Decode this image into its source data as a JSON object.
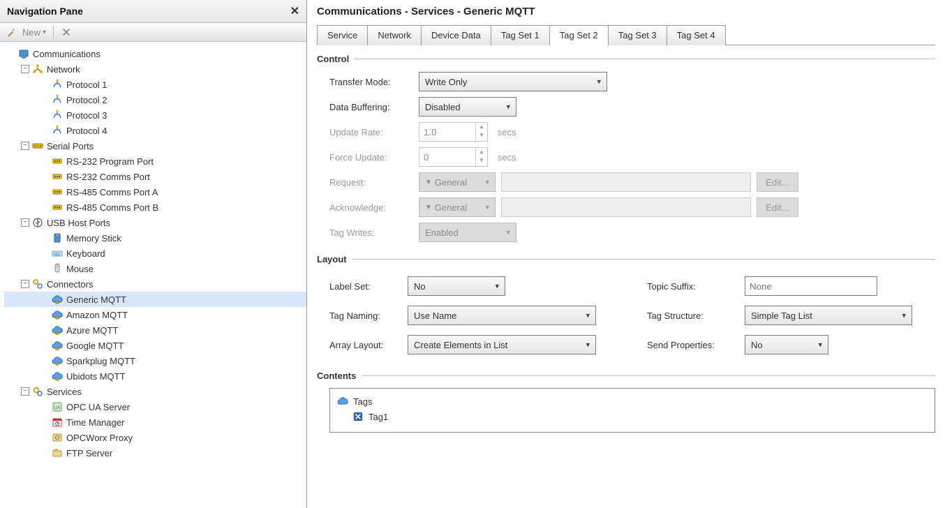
{
  "nav": {
    "title": "Navigation Pane",
    "toolbar": {
      "new": "New",
      "new_arrow": "▾"
    },
    "items": [
      {
        "label": "Communications",
        "level": 1,
        "icon": "comm",
        "expander": ""
      },
      {
        "label": "Network",
        "level": 2,
        "icon": "network",
        "expander": "−"
      },
      {
        "label": "Protocol 1",
        "level": 3,
        "icon": "protocol",
        "expander": ""
      },
      {
        "label": "Protocol 2",
        "level": 3,
        "icon": "protocol",
        "expander": ""
      },
      {
        "label": "Protocol 3",
        "level": 3,
        "icon": "protocol",
        "expander": ""
      },
      {
        "label": "Protocol 4",
        "level": 3,
        "icon": "protocol",
        "expander": ""
      },
      {
        "label": "Serial Ports",
        "level": 2,
        "icon": "serial",
        "expander": "−"
      },
      {
        "label": "RS-232 Program Port",
        "level": 3,
        "icon": "port",
        "expander": ""
      },
      {
        "label": "RS-232 Comms Port",
        "level": 3,
        "icon": "port",
        "expander": ""
      },
      {
        "label": "RS-485 Comms Port A",
        "level": 3,
        "icon": "port",
        "expander": ""
      },
      {
        "label": "RS-485 Comms Port B",
        "level": 3,
        "icon": "port",
        "expander": ""
      },
      {
        "label": "USB Host Ports",
        "level": 2,
        "icon": "usb",
        "expander": "−"
      },
      {
        "label": "Memory Stick",
        "level": 3,
        "icon": "mstick",
        "expander": ""
      },
      {
        "label": "Keyboard",
        "level": 3,
        "icon": "keyboard",
        "expander": ""
      },
      {
        "label": "Mouse",
        "level": 3,
        "icon": "mouse",
        "expander": ""
      },
      {
        "label": "Connectors",
        "level": 2,
        "icon": "connectors",
        "expander": "−"
      },
      {
        "label": "Generic MQTT",
        "level": 3,
        "icon": "cloud",
        "expander": "",
        "selected": true
      },
      {
        "label": "Amazon MQTT",
        "level": 3,
        "icon": "cloud",
        "expander": ""
      },
      {
        "label": "Azure MQTT",
        "level": 3,
        "icon": "cloud",
        "expander": ""
      },
      {
        "label": "Google MQTT",
        "level": 3,
        "icon": "cloud",
        "expander": ""
      },
      {
        "label": "Sparkplug MQTT",
        "level": 3,
        "icon": "cloud",
        "expander": ""
      },
      {
        "label": "Ubidots MQTT",
        "level": 3,
        "icon": "cloud",
        "expander": ""
      },
      {
        "label": "Services",
        "level": 2,
        "icon": "services",
        "expander": "−"
      },
      {
        "label": "OPC UA Server",
        "level": 3,
        "icon": "opcua",
        "expander": ""
      },
      {
        "label": "Time Manager",
        "level": 3,
        "icon": "clock",
        "expander": ""
      },
      {
        "label": "OPCWorx Proxy",
        "level": 3,
        "icon": "opcproxy",
        "expander": ""
      },
      {
        "label": "FTP Server",
        "level": 3,
        "icon": "ftp",
        "expander": ""
      }
    ]
  },
  "main": {
    "breadcrumb": "Communications - Services - Generic MQTT",
    "tabs": [
      "Service",
      "Network",
      "Device Data",
      "Tag Set 1",
      "Tag Set 2",
      "Tag Set 3",
      "Tag Set 4"
    ],
    "active_tab": 4,
    "groups": {
      "control": {
        "title": "Control",
        "transfer_mode": {
          "label": "Transfer Mode:",
          "value": "Write Only"
        },
        "data_buffering": {
          "label": "Data Buffering:",
          "value": "Disabled"
        },
        "update_rate": {
          "label": "Update Rate:",
          "value": "1.0",
          "unit": "secs"
        },
        "force_update": {
          "label": "Force Update:",
          "value": "0",
          "unit": "secs"
        },
        "request": {
          "label": "Request:",
          "combo": "General",
          "edit": "Edit..."
        },
        "acknowledge": {
          "label": "Acknowledge:",
          "combo": "General",
          "edit": "Edit..."
        },
        "tag_writes": {
          "label": "Tag Writes:",
          "value": "Enabled"
        }
      },
      "layout": {
        "title": "Layout",
        "label_set": {
          "label": "Label Set:",
          "value": "No"
        },
        "topic_suffix": {
          "label": "Topic Suffix:",
          "placeholder": "None",
          "value": ""
        },
        "tag_naming": {
          "label": "Tag Naming:",
          "value": "Use Name"
        },
        "tag_structure": {
          "label": "Tag Structure:",
          "value": "Simple Tag List"
        },
        "array_layout": {
          "label": "Array Layout:",
          "value": "Create Elements in List"
        },
        "send_properties": {
          "label": "Send Properties:",
          "value": "No"
        }
      },
      "contents": {
        "title": "Contents",
        "root": "Tags",
        "items": [
          "Tag1"
        ]
      }
    }
  }
}
